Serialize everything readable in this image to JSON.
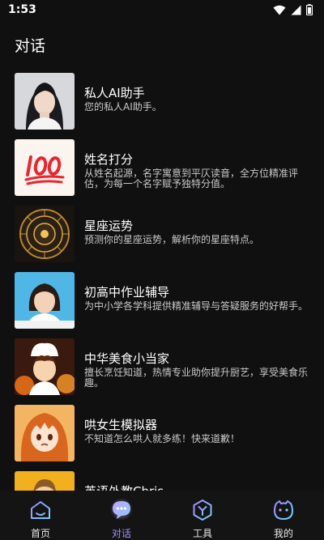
{
  "status_bar": {
    "time": "1:53"
  },
  "header": {
    "title": "对话"
  },
  "chats": [
    {
      "name": "私人AI助手",
      "description": "您的私人AI助手。",
      "avatar": "woman-portrait-avatar"
    },
    {
      "name": "姓名打分",
      "description": "从姓名起源，名字寓意到平仄读音，全方位精准评估，为每一个名字赋予独特分值。",
      "avatar": "100-points-emoji-avatar"
    },
    {
      "name": "星座运势",
      "description": "预测你的星座运势，解析你的星座特点。",
      "avatar": "zodiac-wheel-avatar"
    },
    {
      "name": "初高中作业辅导",
      "description": "为中小学各学科提供精准辅导与答疑服务的好帮手。",
      "avatar": "student-girl-avatar"
    },
    {
      "name": "中华美食小当家",
      "description": "擅长烹饪知道，热情专业助你提升厨艺，享受美食乐趣。",
      "avatar": "chef-boy-avatar"
    },
    {
      "name": "哄女生模拟器",
      "description": "不知道怎么哄人就多练！快来道歉！",
      "avatar": "anime-girl-avatar"
    },
    {
      "name": "英语外教Chris",
      "description": "",
      "avatar": "english-teacher-avatar"
    }
  ],
  "nav": {
    "items": [
      {
        "label": "首页",
        "icon": "home-icon"
      },
      {
        "label": "对话",
        "icon": "chat-bubble-icon",
        "active": true
      },
      {
        "label": "工具",
        "icon": "tools-hexagon-icon"
      },
      {
        "label": "我的",
        "icon": "profile-face-icon"
      }
    ]
  },
  "colors": {
    "background": "#101010",
    "accent": "#a58cff"
  }
}
